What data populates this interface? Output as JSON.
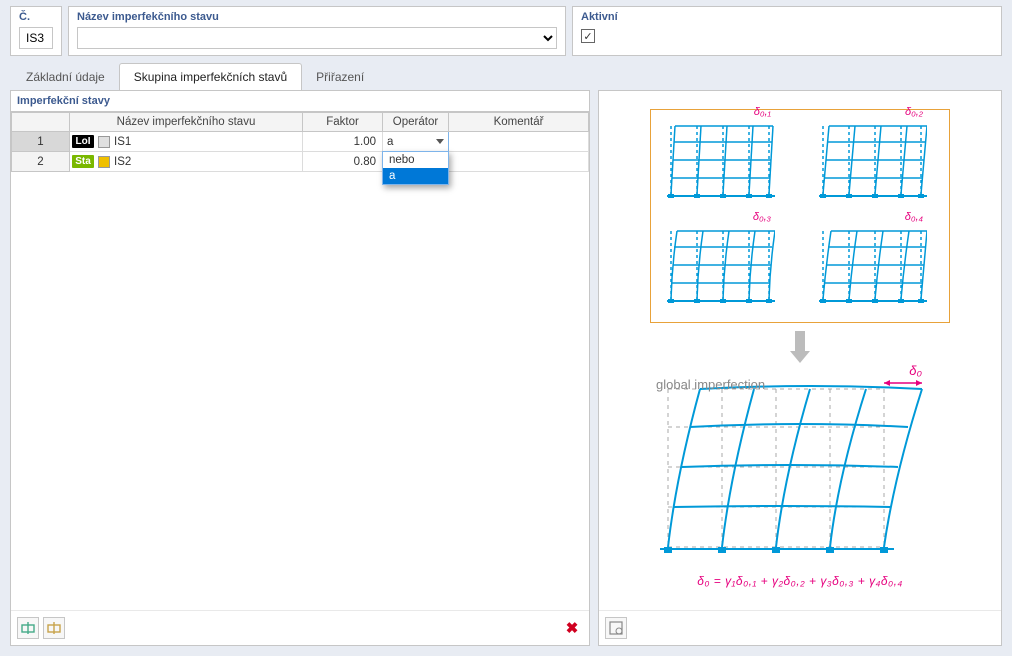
{
  "header": {
    "number_label": "Č.",
    "number_value": "IS3",
    "name_label": "Název imperfekčního stavu",
    "name_value": "",
    "active_label": "Aktivní",
    "active_checked": true
  },
  "tabs": {
    "items": [
      {
        "label": "Základní údaje"
      },
      {
        "label": "Skupina imperfekčních stavů"
      },
      {
        "label": "Přiřazení"
      }
    ],
    "active_index": 1
  },
  "left_panel": {
    "title": "Imperfekční stavy",
    "columns": {
      "name": "Název imperfekčního stavu",
      "factor": "Faktor",
      "operator": "Operátor",
      "comment": "Komentář"
    },
    "rows": [
      {
        "num": "1",
        "tag": "LoI",
        "tag_class": "lol",
        "sq": "gray",
        "name": "IS1",
        "factor": "1.00",
        "operator": "a",
        "selected": true
      },
      {
        "num": "2",
        "tag": "Sta",
        "tag_class": "sta",
        "sq": "gold",
        "name": "IS2",
        "factor": "0.80",
        "operator": "",
        "selected": false
      }
    ],
    "dropdown": {
      "open_on_row": 0,
      "selected_value": "a",
      "options": [
        "nebo",
        "a"
      ]
    }
  },
  "preview": {
    "deltas": [
      "δ₀,₁",
      "δ₀,₂",
      "δ₀,₃",
      "δ₀,₄"
    ],
    "global_label": "global imperfection",
    "delta0": "δ₀",
    "formula": "δ₀ = γ₁δ₀,₁ + γ₂δ₀,₂ + γ₃δ₀,₃ + γ₄δ₀,₄"
  }
}
